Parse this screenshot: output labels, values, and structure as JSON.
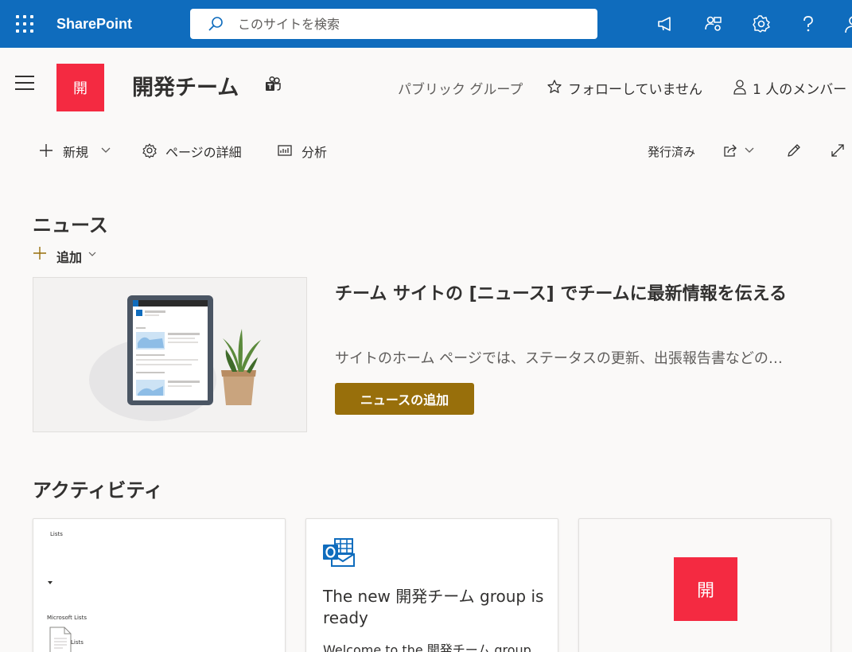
{
  "suite_bar": {
    "brand": "SharePoint",
    "search_placeholder": "このサイトを検索",
    "icons": [
      "waffle-icon",
      "megaphone-icon",
      "people-settings-icon",
      "gear-icon",
      "help-icon",
      "account-icon"
    ],
    "accent": "#0f6cbd"
  },
  "site": {
    "logo_text": "開",
    "title": "開発チーム",
    "group_type": "パブリック グループ",
    "follow": "フォローしていません",
    "members": "1 人のメンバー",
    "logo_color": "#f42a41"
  },
  "command_bar": {
    "new": "新規",
    "page_details": "ページの詳細",
    "analytics": "分析",
    "status": "発行済み"
  },
  "news": {
    "heading": "ニュース",
    "add_label": "追加",
    "headline": "チーム サイトの [ニュース] でチームに最新情報を伝える",
    "description": "サイトのホーム ページでは、ステータスの更新、出張報告書などの…",
    "button": "ニュースの追加",
    "button_color": "#986f0b"
  },
  "activity": {
    "heading": "アクティビティ",
    "cards": [
      {
        "thumb_lines": [
          "Lists",
          "Microsoft Lists",
          "Lists"
        ]
      },
      {
        "title": "The new 開発チーム group is ready",
        "subtitle": "Welcome to the 開発チーム group."
      },
      {
        "logo_text": "開"
      }
    ]
  }
}
